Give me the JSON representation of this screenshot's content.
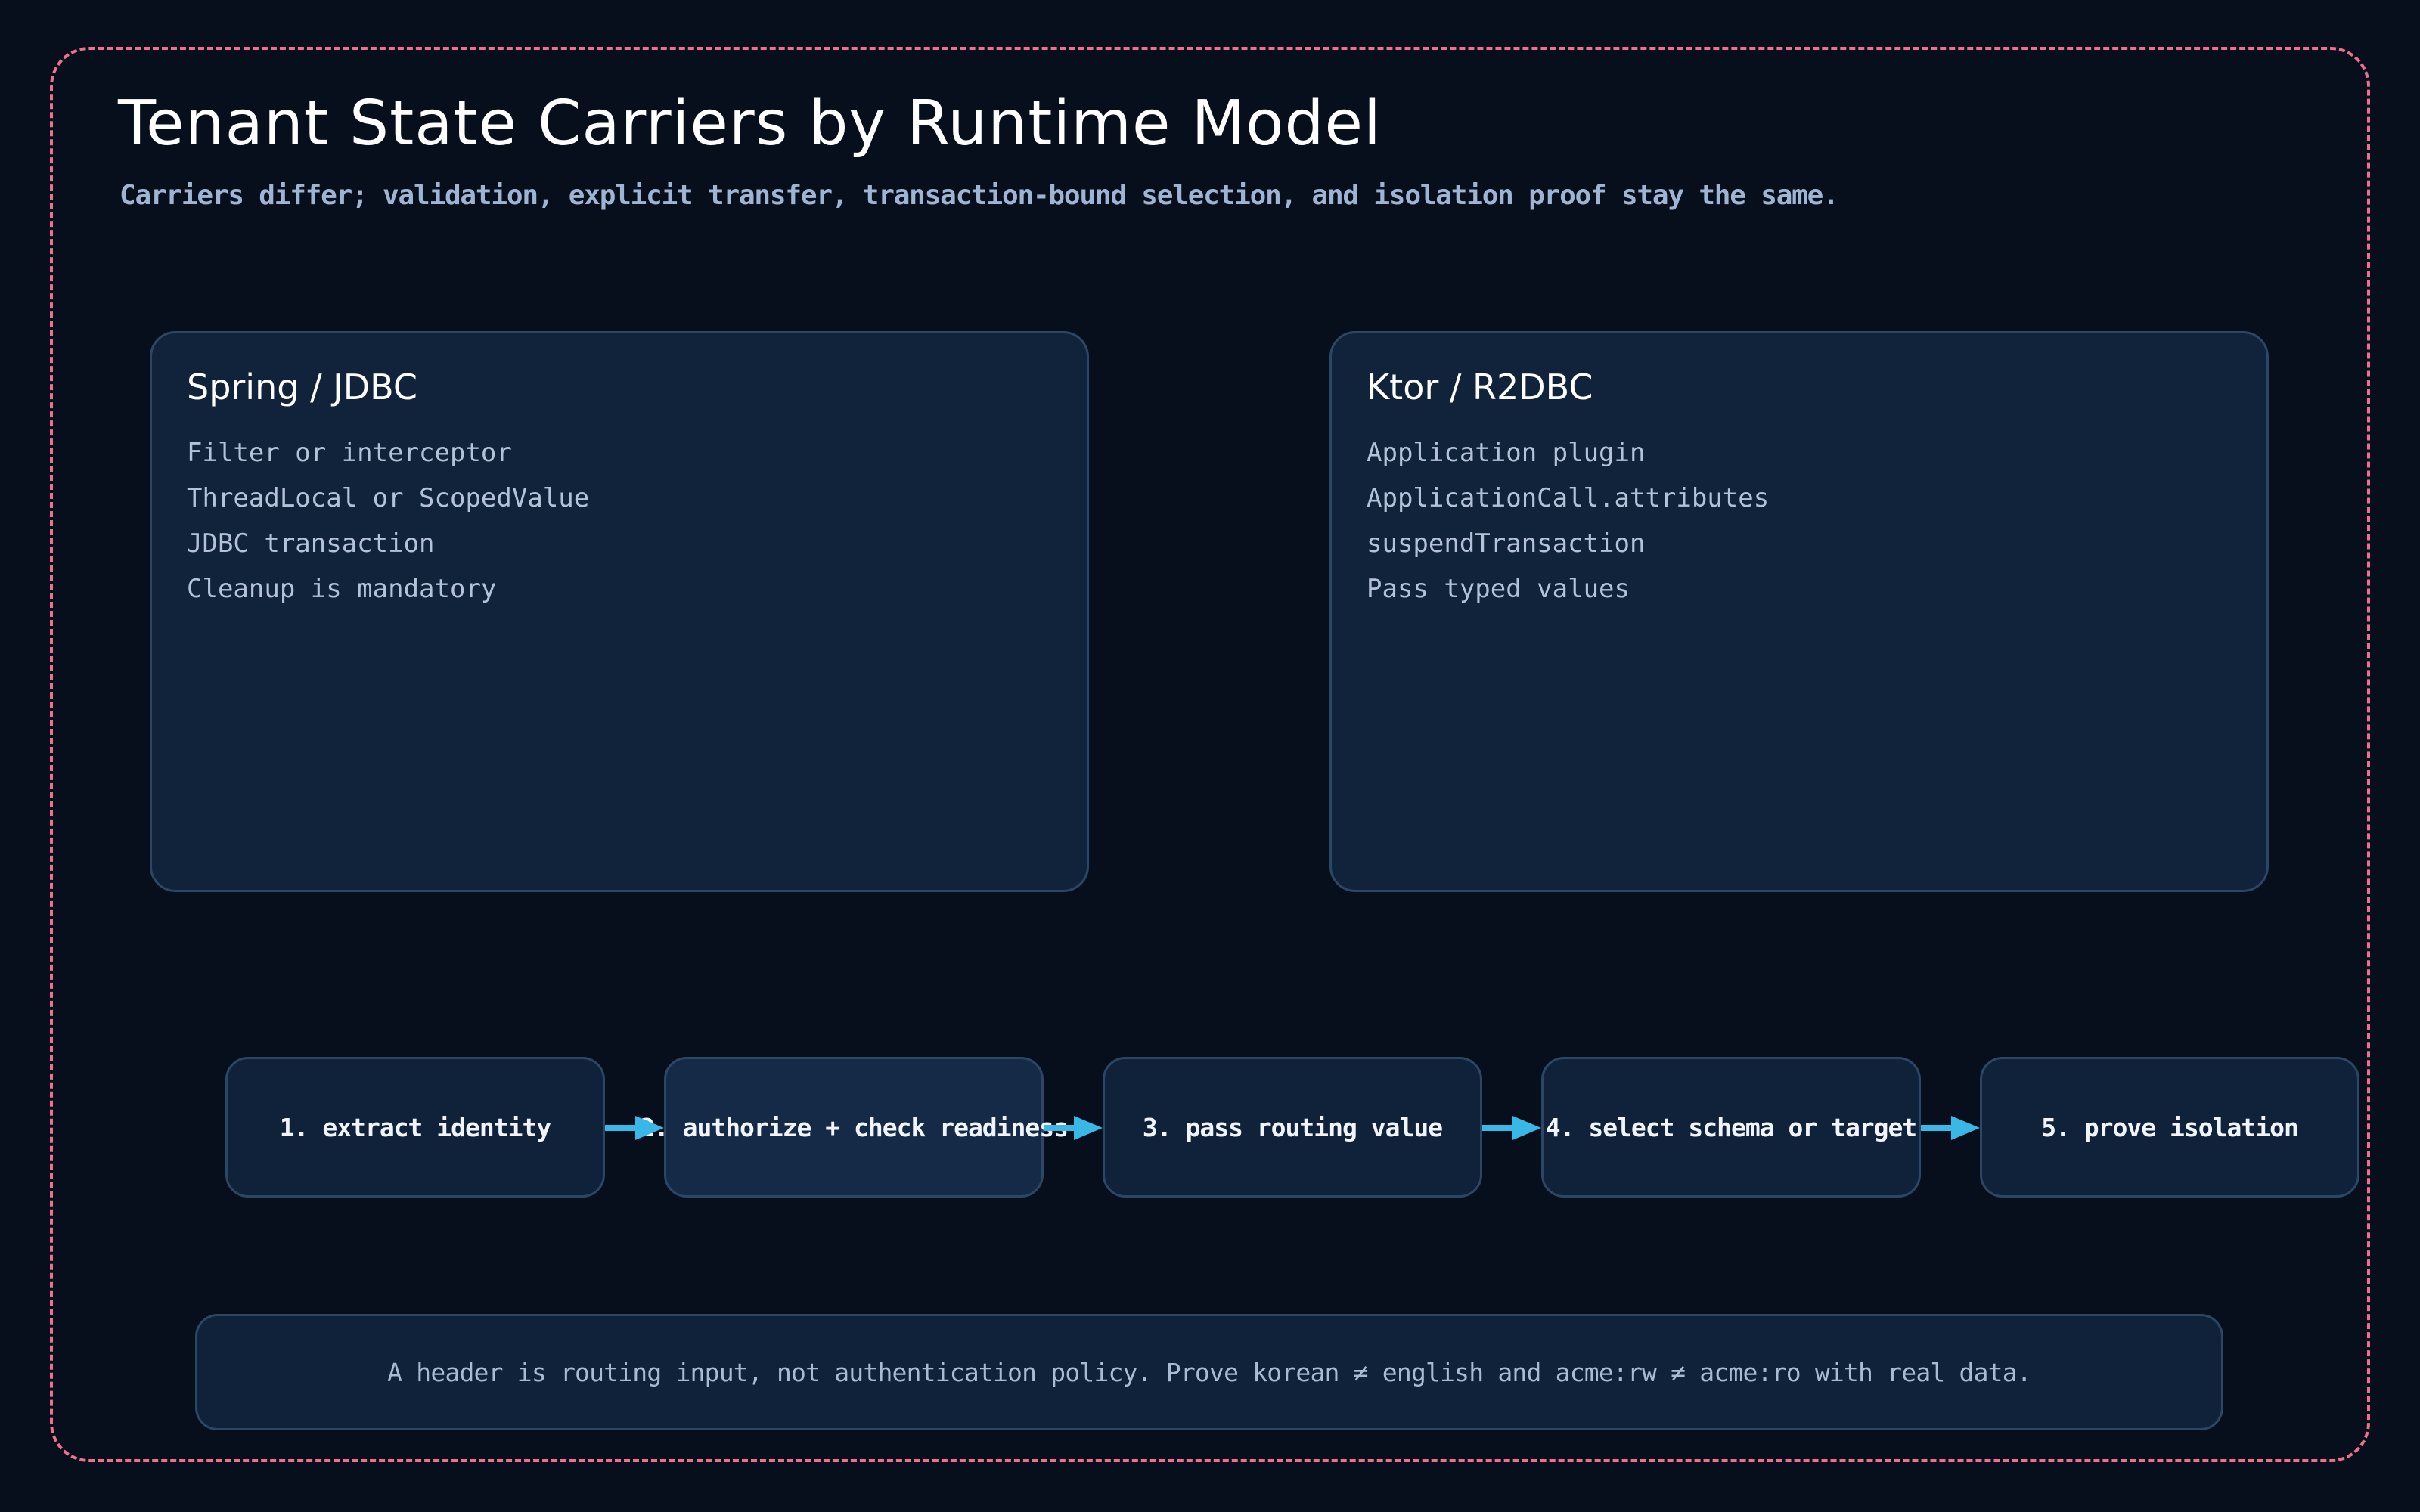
{
  "header": {
    "title": "Tenant State Carriers by Runtime Model",
    "subtitle": "Carriers differ; validation, explicit transfer, transaction-bound selection, and isolation proof stay the same."
  },
  "runtimes": [
    {
      "title": "Spring / JDBC",
      "items": [
        "Filter or interceptor",
        "ThreadLocal or ScopedValue",
        "JDBC transaction",
        "Cleanup is mandatory"
      ]
    },
    {
      "title": "Ktor / R2DBC",
      "items": [
        "Application plugin",
        "ApplicationCall.attributes",
        "suspendTransaction",
        "Pass typed values"
      ]
    }
  ],
  "flow": {
    "steps": [
      "1. extract identity",
      "2. authorize + check readiness",
      "3. pass routing value",
      "4. select schema or target",
      "5. prove isolation"
    ],
    "arrow_color": "#39b8e8"
  },
  "note": {
    "text": "A header is routing input, not authentication policy. Prove korean ≠ english and acme:rw ≠ acme:ro with real data."
  },
  "colors": {
    "background": "#070f1c",
    "frame_border": "#ef6f8c",
    "card_fill": "#11233a",
    "card_border": "#2c4766"
  }
}
